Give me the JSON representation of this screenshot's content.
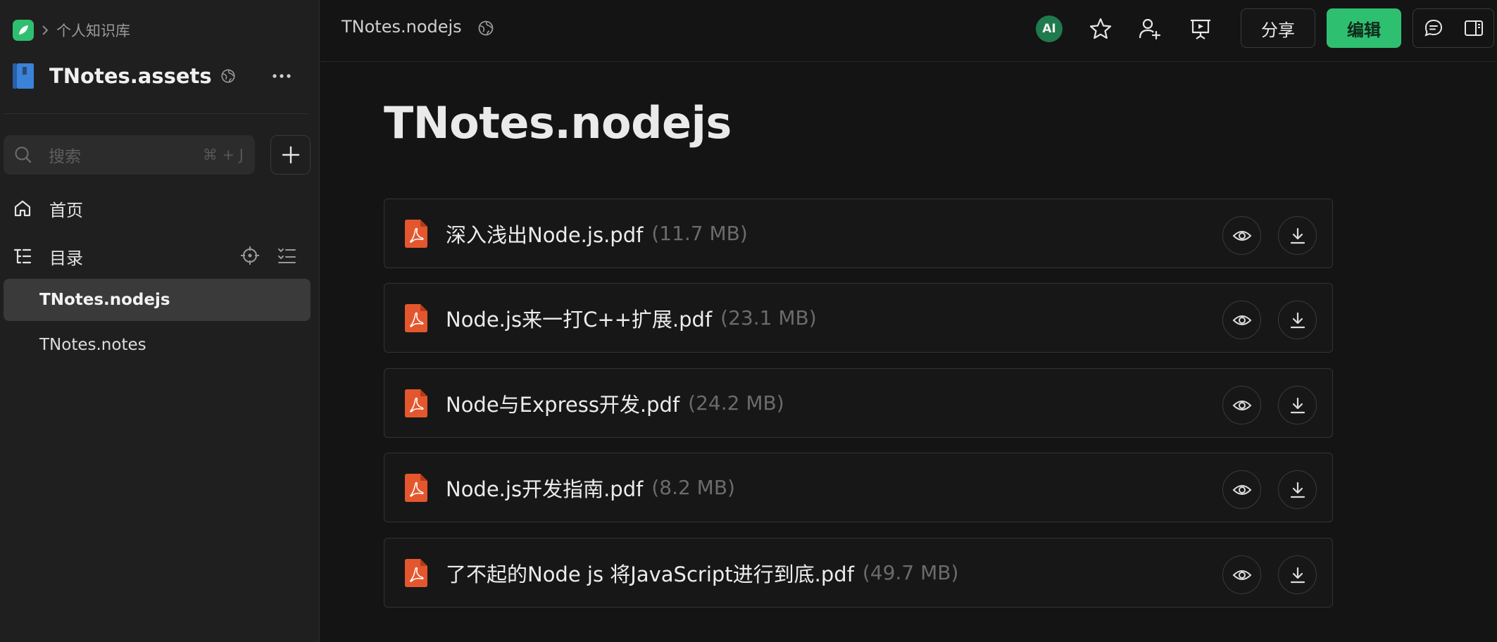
{
  "sidebar": {
    "breadcrumb": "个人知识库",
    "kb_title": "TNotes.assets",
    "search_placeholder": "搜索",
    "search_shortcut": "⌘ + J",
    "nav": [
      {
        "label": "首页",
        "icon": "home-icon"
      },
      {
        "label": "目录",
        "icon": "toc-icon"
      }
    ],
    "docs": [
      {
        "label": "TNotes.nodejs",
        "active": true
      },
      {
        "label": "TNotes.notes",
        "active": false
      }
    ]
  },
  "topbar": {
    "doc_title": "TNotes.nodejs",
    "ai_label": "AI",
    "share_label": "分享",
    "edit_label": "编辑"
  },
  "main": {
    "title": "TNotes.nodejs",
    "files": [
      {
        "name": "深入浅出Node.js.pdf",
        "size": "(11.7 MB)"
      },
      {
        "name": "Node.js来一打C++扩展.pdf",
        "size": "(23.1 MB)"
      },
      {
        "name": "Node与Express开发.pdf",
        "size": "(24.2 MB)"
      },
      {
        "name": "Node.js开发指南.pdf",
        "size": "(8.2 MB)"
      },
      {
        "name": "了不起的Node js 将JavaScript进行到底.pdf",
        "size": "(49.7 MB)"
      }
    ]
  },
  "colors": {
    "accent": "#2fbf71",
    "pdf": "#e4572e",
    "book": "#3b82d9"
  }
}
